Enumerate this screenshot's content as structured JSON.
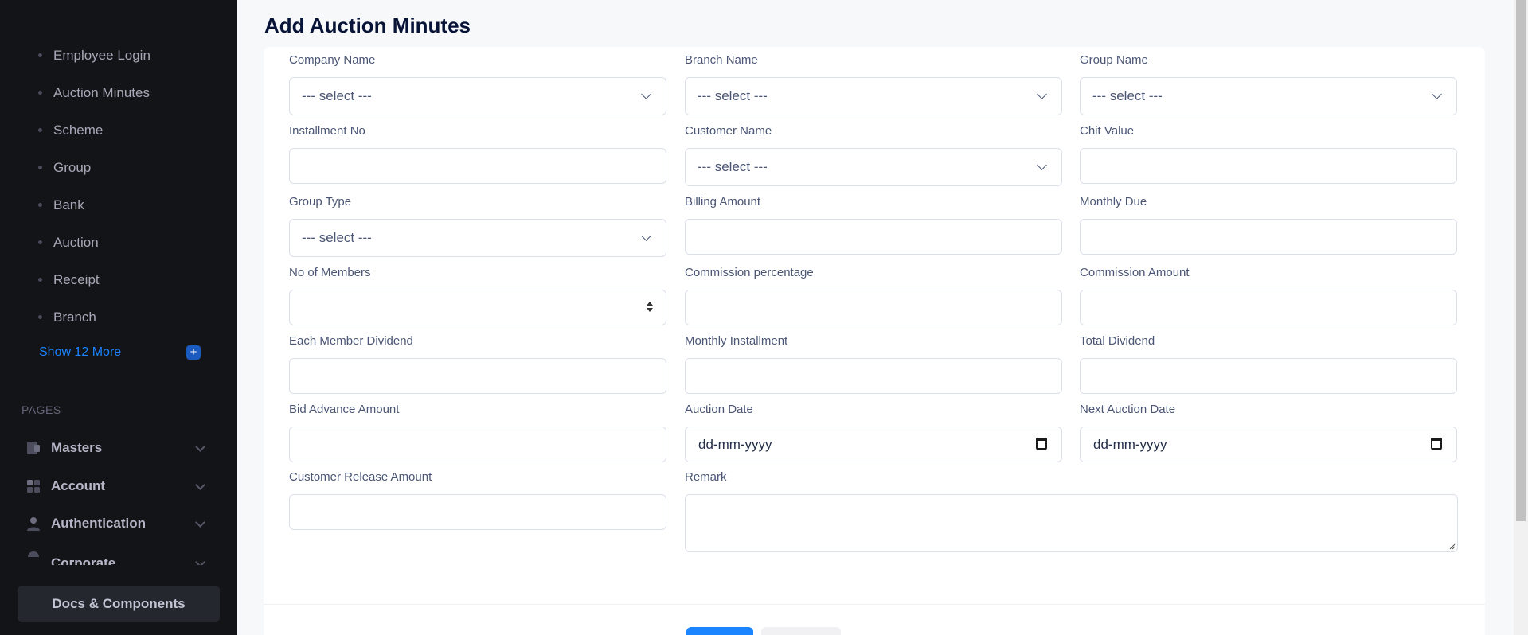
{
  "sidebar": {
    "items": [
      {
        "label": "Employee Login"
      },
      {
        "label": "Auction Minutes"
      },
      {
        "label": "Scheme"
      },
      {
        "label": "Group"
      },
      {
        "label": "Bank"
      },
      {
        "label": "Auction"
      },
      {
        "label": "Receipt"
      },
      {
        "label": "Branch"
      }
    ],
    "show_more": "Show 12 More",
    "pages_label": "PAGES",
    "menus": [
      {
        "label": "Masters",
        "icon": "masters-icon"
      },
      {
        "label": "Account",
        "icon": "account-icon"
      },
      {
        "label": "Authentication",
        "icon": "user-icon"
      },
      {
        "label": "Corporate",
        "icon": "corporate-icon"
      }
    ],
    "docs_button": "Docs & Components"
  },
  "page": {
    "title": "Add Auction Minutes"
  },
  "form": {
    "company_name": {
      "label": "Company Name",
      "value": "--- select ---"
    },
    "branch_name": {
      "label": "Branch Name",
      "value": "--- select ---"
    },
    "group_name": {
      "label": "Group Name",
      "value": "--- select ---"
    },
    "installment_no": {
      "label": "Installment No"
    },
    "customer_name": {
      "label": "Customer Name",
      "value": "--- select ---"
    },
    "chit_value": {
      "label": "Chit Value"
    },
    "group_type": {
      "label": "Group Type",
      "value": "--- select ---"
    },
    "billing_amount": {
      "label": "Billing Amount"
    },
    "monthly_due": {
      "label": "Monthly Due"
    },
    "no_of_members": {
      "label": "No of Members"
    },
    "commission_percentage": {
      "label": "Commission percentage"
    },
    "commission_amount": {
      "label": "Commission Amount"
    },
    "each_member_dividend": {
      "label": "Each Member Dividend"
    },
    "monthly_installment": {
      "label": "Monthly Installment"
    },
    "total_dividend": {
      "label": "Total Dividend"
    },
    "bid_advance_amount": {
      "label": "Bid Advance Amount"
    },
    "auction_date": {
      "label": "Auction Date",
      "value": "dd-mm-yyyy"
    },
    "next_auction_date": {
      "label": "Next Auction Date",
      "value": "dd-mm-yyyy"
    },
    "customer_release_amount": {
      "label": "Customer Release Amount"
    },
    "remark": {
      "label": "Remark"
    }
  },
  "colors": {
    "sidebar_bg": "#131417",
    "accent": "#1b84ff"
  }
}
